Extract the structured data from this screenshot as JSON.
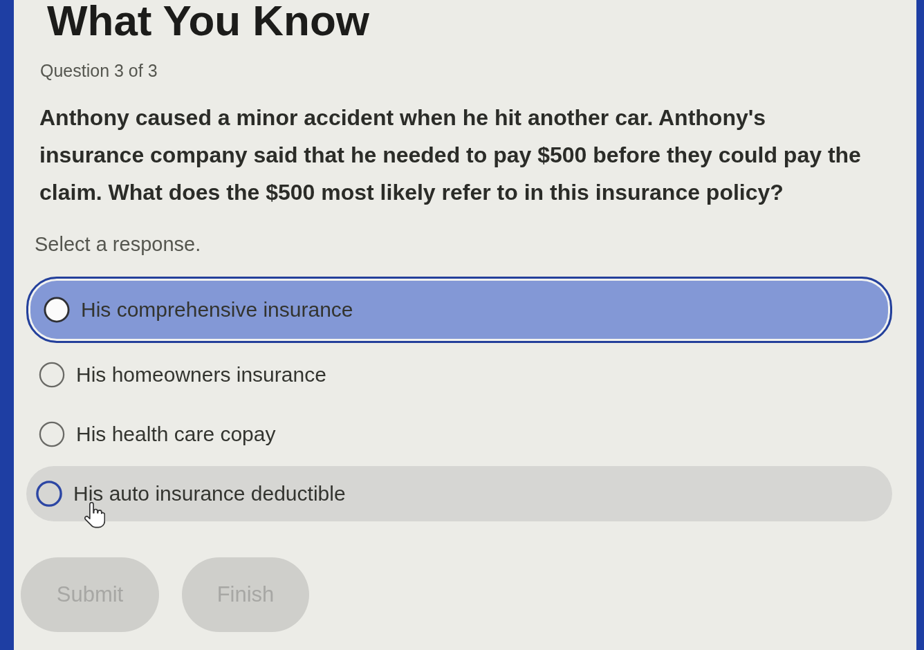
{
  "page": {
    "title": "What You Know",
    "progress": "Question 3 of 3"
  },
  "question": {
    "prompt": "Anthony caused a minor accident when he hit another car. Anthony's insurance company said that he needed to pay $500 before they could pay the claim. What does the $500 most likely refer to in this insurance policy?",
    "instruction": "Select a response."
  },
  "options": [
    {
      "label": "His comprehensive insurance",
      "selected": true,
      "hovered": false
    },
    {
      "label": "His homeowners insurance",
      "selected": false,
      "hovered": false
    },
    {
      "label": "His health care copay",
      "selected": false,
      "hovered": false
    },
    {
      "label": "His auto insurance deductible",
      "selected": false,
      "hovered": true
    }
  ],
  "buttons": [
    {
      "label": "Submit",
      "disabled": true
    },
    {
      "label": "Finish",
      "disabled": true
    }
  ]
}
